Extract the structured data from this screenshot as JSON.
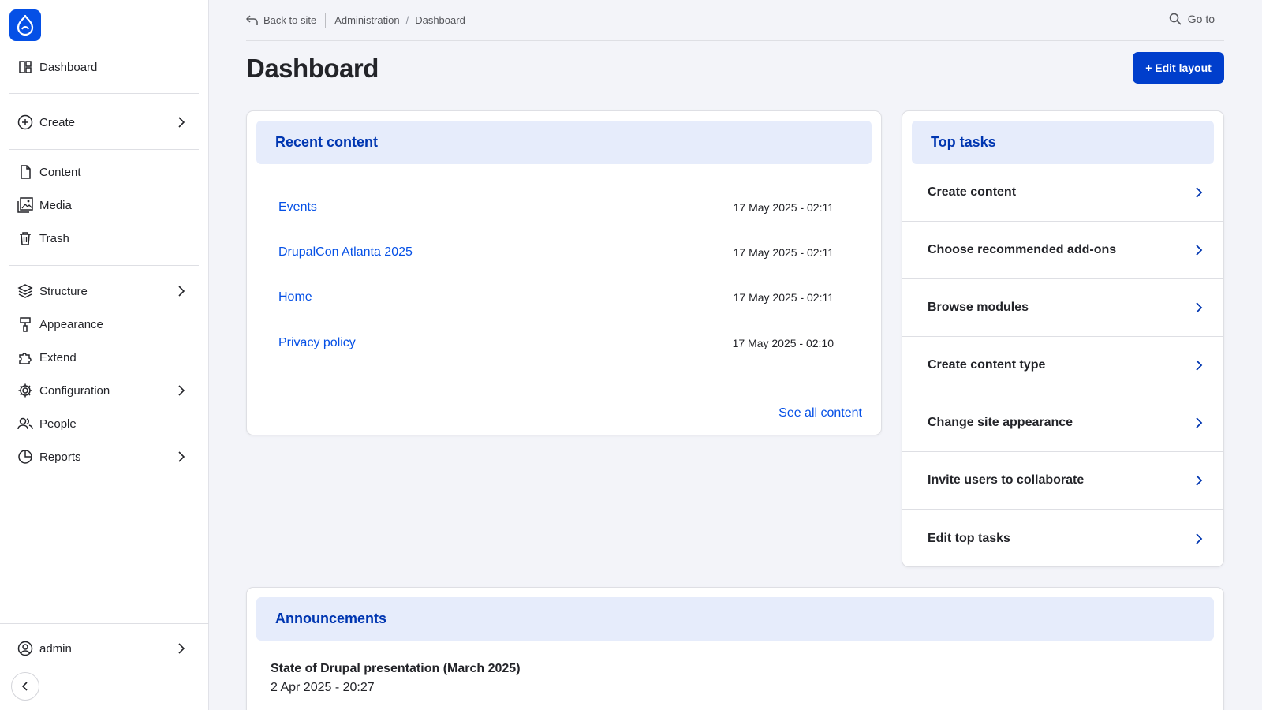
{
  "sidebar": {
    "items": [
      {
        "label": "Dashboard"
      },
      {
        "label": "Create"
      },
      {
        "label": "Content"
      },
      {
        "label": "Media"
      },
      {
        "label": "Trash"
      },
      {
        "label": "Structure"
      },
      {
        "label": "Appearance"
      },
      {
        "label": "Extend"
      },
      {
        "label": "Configuration"
      },
      {
        "label": "People"
      },
      {
        "label": "Reports"
      }
    ],
    "user": "admin"
  },
  "topbar": {
    "back": "Back to site",
    "breadcrumb": [
      "Administration",
      "Dashboard"
    ],
    "separator": "/",
    "goto": "Go to"
  },
  "page": {
    "title": "Dashboard",
    "edit_layout": "+ Edit layout"
  },
  "recent_content": {
    "title": "Recent content",
    "rows": [
      {
        "title": "Events",
        "date": "17 May 2025 - 02:11"
      },
      {
        "title": "DrupalCon Atlanta 2025",
        "date": "17 May 2025 - 02:11"
      },
      {
        "title": "Home",
        "date": "17 May 2025 - 02:11"
      },
      {
        "title": "Privacy policy",
        "date": "17 May 2025 - 02:10"
      }
    ],
    "see_all": "See all content"
  },
  "top_tasks": {
    "title": "Top tasks",
    "items": [
      "Create content",
      "Choose recommended add-ons",
      "Browse modules",
      "Create content type",
      "Change site appearance",
      "Invite users to collaborate",
      "Edit top tasks"
    ]
  },
  "announcements": {
    "title": "Announcements",
    "items": [
      {
        "title": "State of Drupal presentation (March 2025)",
        "date": "2 Apr 2025 - 20:27"
      }
    ]
  },
  "colors": {
    "accent": "#0550e6",
    "button": "#003ecc",
    "card_head_bg": "#e6ecfb",
    "card_head_text": "#0036b1"
  }
}
